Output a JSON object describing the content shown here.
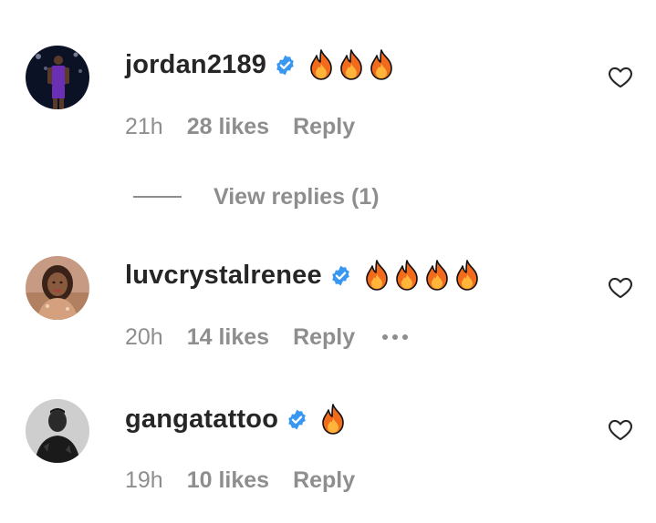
{
  "comments": [
    {
      "username": "jordan2189",
      "verified": true,
      "emoji": "🔥🔥🔥",
      "flame_count": 3,
      "time": "21h",
      "likes": "28 likes",
      "reply_label": "Reply",
      "view_replies": "View replies (1)"
    },
    {
      "username": "luvcrystalrenee",
      "verified": true,
      "emoji": "🔥🔥🔥🔥",
      "flame_count": 4,
      "time": "20h",
      "likes": "14 likes",
      "reply_label": "Reply",
      "more_icon": "more-dots-icon"
    },
    {
      "username": "gangatattoo",
      "verified": true,
      "emoji": "🔥",
      "flame_count": 1,
      "time": "19h",
      "likes": "10 likes",
      "reply_label": "Reply"
    }
  ],
  "colors": {
    "username": "#262626",
    "meta": "#8e8e8e",
    "verified_badge": "#3897f0",
    "flame_outer": "#f26a1b",
    "flame_inner": "#ffb43a"
  },
  "icons": {
    "verified": "verified-badge-icon",
    "flame": "fire-emoji-icon",
    "heart": "heart-outline-icon"
  }
}
